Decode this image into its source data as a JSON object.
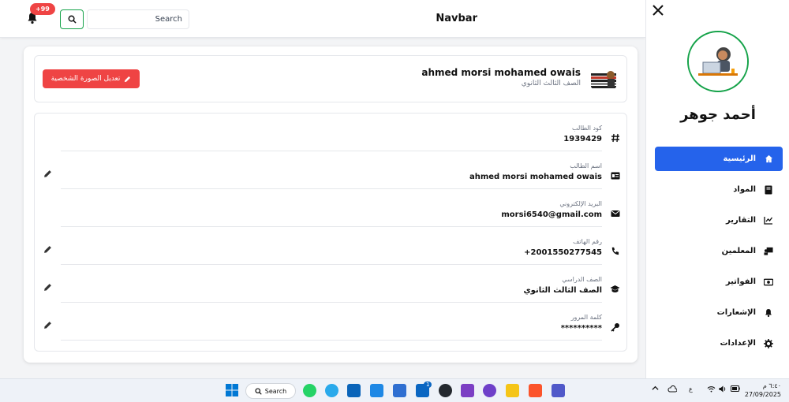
{
  "navbar": {
    "title": "Navbar",
    "search_placeholder": "Search",
    "notification_count": "+99"
  },
  "profile": {
    "name": "ahmed morsi mohamed owais",
    "grade": "الصف الثالث الثانوي",
    "edit_photo_label": "تعديل الصورة الشخصية"
  },
  "details": [
    {
      "label": "كود الطالب",
      "value": "1939429",
      "icon": "hash-icon",
      "editable": false
    },
    {
      "label": "اسم الطالب",
      "value": "ahmed morsi mohamed owais",
      "icon": "id-card-icon",
      "editable": true
    },
    {
      "label": "البريد الإلكتروني",
      "value": "morsi6540@gmail.com",
      "icon": "envelope-icon",
      "editable": false
    },
    {
      "label": "رقم الهاتف",
      "value": "+2001550277545",
      "icon": "phone-icon",
      "editable": true
    },
    {
      "label": "الصف الدراسي",
      "value": "الصف الثالث الثانوي",
      "icon": "graduation-cap-icon",
      "editable": true
    },
    {
      "label": "كلمة المرور",
      "value": "**********",
      "icon": "key-icon",
      "editable": true
    }
  ],
  "sidebar": {
    "user_name": "أحمد جوهر",
    "items": [
      {
        "label": "الرئيسية",
        "icon": "home-icon",
        "active": true
      },
      {
        "label": "المواد",
        "icon": "book-icon",
        "active": false
      },
      {
        "label": "التقارير",
        "icon": "chart-line-icon",
        "active": false
      },
      {
        "label": "المعلمين",
        "icon": "teacher-icon",
        "active": false
      },
      {
        "label": "الفواتير",
        "icon": "money-bill-icon",
        "active": false
      },
      {
        "label": "الإشعارات",
        "icon": "bell-icon",
        "active": false
      },
      {
        "label": "الإعدادات",
        "icon": "gear-icon",
        "active": false
      }
    ]
  },
  "taskbar": {
    "search_label": "Search",
    "linkedin_badge": "1",
    "language": "ع",
    "time": "٦:٤٠ م",
    "date": "27/09/2025"
  },
  "colors": {
    "primary": "#2563eb",
    "danger": "#ef4444",
    "success": "#16a34a"
  }
}
